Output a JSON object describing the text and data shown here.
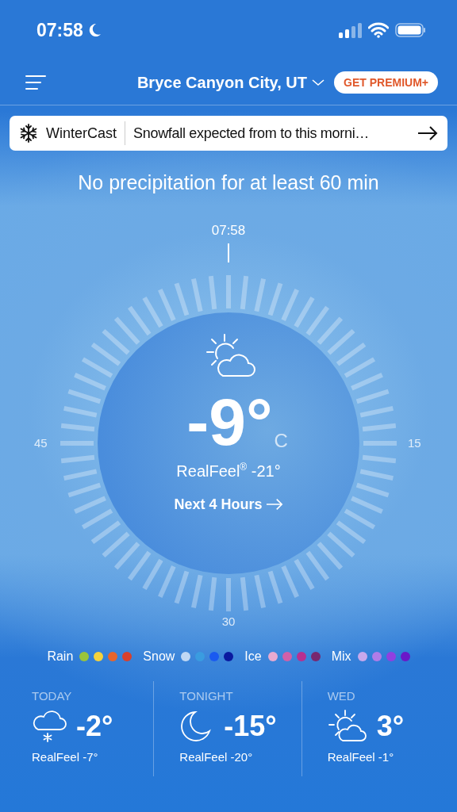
{
  "status_bar": {
    "time": "07:58"
  },
  "header": {
    "location": "Bryce Canyon City, UT",
    "premium_button": "GET PREMIUM+"
  },
  "banner": {
    "title": "WinterCast",
    "message": "Snowfall expected from to this morni…"
  },
  "precipitation_summary": "No precipitation for at least 60 min",
  "dial": {
    "top_label": "07:58",
    "right_label": "15",
    "bottom_label": "30",
    "left_label": "45"
  },
  "current": {
    "temperature": "-9°",
    "unit": "C",
    "realfeel": "RealFeel$^{®}$ -21°",
    "link": "Next 4 Hours"
  },
  "legend": [
    {
      "label": "Rain",
      "dots": [
        {
          "color": "#9ac43c"
        },
        {
          "color": "#f5d23c"
        },
        {
          "color": "#e8652c"
        },
        {
          "color": "#d8402c"
        }
      ]
    },
    {
      "label": "Snow",
      "dots": [
        {
          "color": "#c0d8f4"
        },
        {
          "color": "#3a9ce0"
        },
        {
          "color": "#1a5af0"
        },
        {
          "color": "#0a1aa0"
        }
      ]
    },
    {
      "label": "Ice",
      "dots": [
        {
          "color": "#e8aad0"
        },
        {
          "color": "#d060a8"
        },
        {
          "color": "#b83090"
        },
        {
          "color": "#782870"
        }
      ]
    },
    {
      "label": "Mix",
      "dots": [
        {
          "color": "#c8a8ec"
        },
        {
          "color": "#b07ce8"
        },
        {
          "color": "#9040e0"
        },
        {
          "color": "#6a18c8"
        }
      ]
    }
  ],
  "forecast": [
    {
      "label": "TODAY",
      "kind": "snow",
      "temperature": "-2°",
      "realfeel": "RealFeel -7°"
    },
    {
      "label": "TONIGHT",
      "kind": "moon",
      "temperature": "-15°",
      "realfeel": "RealFeel -20°"
    },
    {
      "label": "WED",
      "kind": "partly-sunny",
      "temperature": "3°",
      "realfeel": "RealFeel -1°"
    }
  ]
}
